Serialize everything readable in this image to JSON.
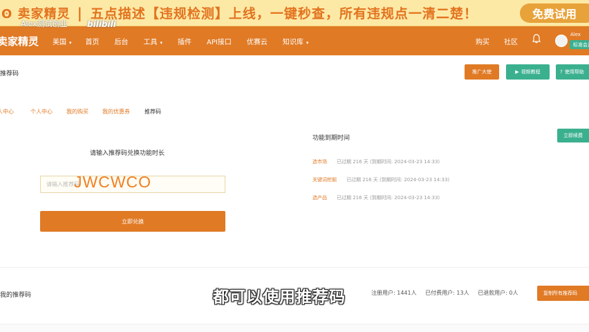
{
  "promo": {
    "logo": "ʘ 卖家精灵",
    "separator": "|",
    "headline": "五点描述【违规检测】上线，一键秒查，所有违规点一清二楚！",
    "try_button": "免费试用"
  },
  "watermark": {
    "text": "Alex测试创业",
    "bili": "bilibili"
  },
  "navbar": {
    "brand": "卖家精灵",
    "items": [
      {
        "label": "美国"
      },
      {
        "label": "首页"
      },
      {
        "label": "后台"
      },
      {
        "label": "工具"
      },
      {
        "label": "插件"
      },
      {
        "label": "API接口"
      },
      {
        "label": "优赛云"
      },
      {
        "label": "知识库"
      }
    ],
    "buy": "购买",
    "community": "社区",
    "user_name": "Alex",
    "user_badge": "标准会员"
  },
  "header": {
    "page_label": "推荐码",
    "promoter_button": "推广大使",
    "tutorial_button": "视频教程",
    "help_button": "使用帮助"
  },
  "tabs": [
    {
      "label": "个人中心"
    },
    {
      "label": "个人中心"
    },
    {
      "label": "我的购买"
    },
    {
      "label": "我的优惠券"
    },
    {
      "label": "推荐码"
    }
  ],
  "redeem": {
    "title": "请输入推荐码兑换功能时长",
    "placeholder": "请输入推荐码",
    "code_overlay": "JWCWCO",
    "button": "立即兑换"
  },
  "expiry": {
    "title": "功能到期时间",
    "renew_button": "立即续费",
    "rows": [
      {
        "name": "选市场",
        "status": "已过期 216 天 (到期时间: 2024-03-23 14:33)"
      },
      {
        "name": "关键词挖掘",
        "status": "已过期 216 天 (到期时间: 2024-03-23 14:33)"
      },
      {
        "name": "选产品",
        "status": "已过期 216 天 (到期时间: 2024-03-23 14:33)"
      }
    ]
  },
  "codes": {
    "title": "我的推荐码",
    "registered": "注册用户: 1441人",
    "paid": "已付费用户: 13人",
    "refunded": "已退款用户: 0人",
    "copy_button": "复制所有推荐码"
  },
  "subtitle": "都可以使用推荐码"
}
